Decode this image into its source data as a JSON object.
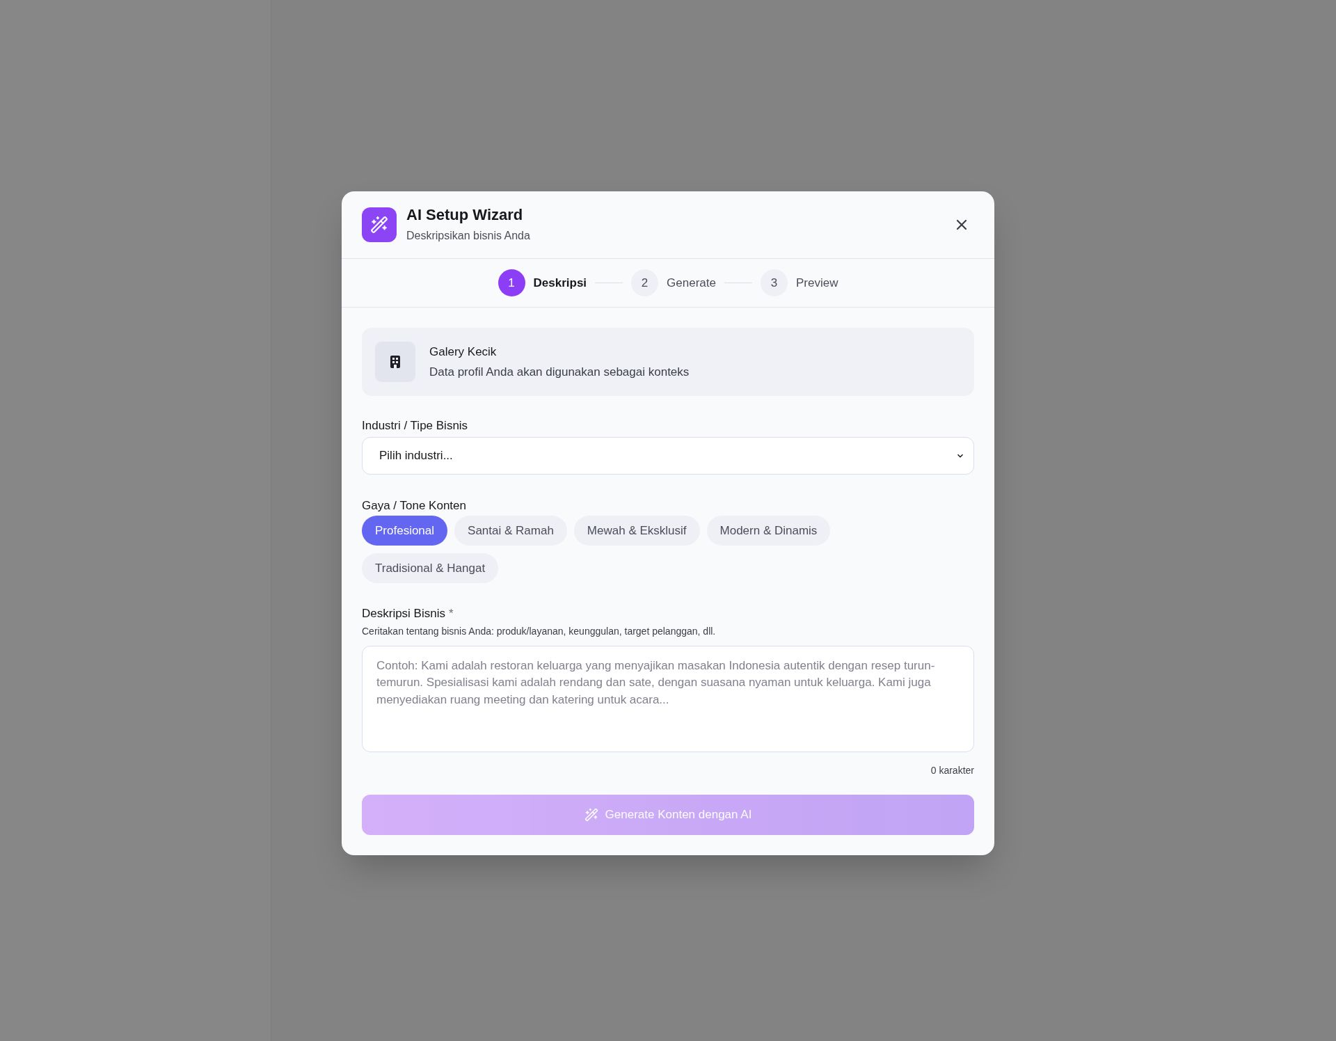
{
  "dialog": {
    "title": "AI Setup Wizard",
    "subtitle": "Deskripsikan bisnis Anda"
  },
  "steps": [
    {
      "number": "1",
      "label": "Deskripsi",
      "selected": true
    },
    {
      "number": "2",
      "label": "Generate",
      "selected": false
    },
    {
      "number": "3",
      "label": "Preview",
      "selected": false
    }
  ],
  "profile_card": {
    "name": "Galery Kecik",
    "note": "Data profil Anda akan digunakan sebagai konteks"
  },
  "industry": {
    "label": "Industri / Tipe Bisnis",
    "value": "Pilih industri..."
  },
  "tone": {
    "label": "Gaya / Tone Konten",
    "options": [
      {
        "label": "Profesional",
        "selected": true
      },
      {
        "label": "Santai & Ramah",
        "selected": false
      },
      {
        "label": "Mewah & Eksklusif",
        "selected": false
      },
      {
        "label": "Modern & Dinamis",
        "selected": false
      },
      {
        "label": "Tradisional & Hangat",
        "selected": false
      }
    ]
  },
  "description": {
    "label": "Deskripsi Bisnis",
    "required_mark": "*",
    "hint": "Ceritakan tentang bisnis Anda: produk/layanan, keunggulan, target pelanggan, dll.",
    "placeholder": "Contoh: Kami adalah restoran keluarga yang menyajikan masakan Indonesia autentik dengan resep turun-temurun. Spesialisasi kami adalah rendang dan sate, dengan suasana nyaman untuk keluarga. Kami juga menyediakan ruang meeting dan katering untuk acara...",
    "count": "0 karakter"
  },
  "generate_button": {
    "label": "Generate Konten dengan AI",
    "disabled": true
  }
}
